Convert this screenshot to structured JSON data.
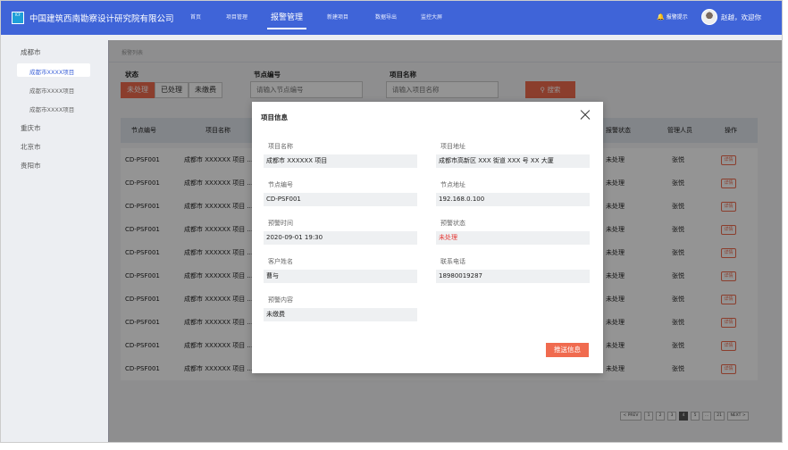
{
  "header": {
    "logo_text": "ICF",
    "org_name": "中国建筑西南勘察设计研究院有限公司",
    "nav": [
      "首页",
      "项目管理",
      "报警管理",
      "新建项目",
      "数据导出",
      "监控大屏"
    ],
    "alert_label": "报警提示",
    "welcome": "赵越，欢迎你"
  },
  "sidebar": {
    "groups": [
      {
        "label": "成都市",
        "children": [
          "成都市XXXX项目",
          "成都市XXXX项目",
          "成都市XXXX项目"
        ]
      },
      {
        "label": "重庆市"
      },
      {
        "label": "北京市"
      },
      {
        "label": "贵阳市"
      }
    ]
  },
  "main": {
    "breadcrumb": "报警列表",
    "filters": {
      "status_label": "状态",
      "status_options": [
        "未处理",
        "已处理",
        "未缴费"
      ],
      "node_label": "节点编号",
      "node_placeholder": "请输入节点编号",
      "project_label": "项目名称",
      "project_placeholder": "请输入项目名称",
      "search_label": "搜索"
    },
    "table": {
      "columns": [
        "节点编号",
        "项目名称",
        "报警状态",
        "管理人员",
        "操作"
      ],
      "rows": [
        {
          "node": "CD-PSF001",
          "project": "成都市 XXXXXX 项目 ...",
          "status": "未处理",
          "manager": "张悦",
          "action": "详情"
        },
        {
          "node": "CD-PSF001",
          "project": "成都市 XXXXXX 项目 ...",
          "status": "未处理",
          "manager": "张悦",
          "action": "详情"
        },
        {
          "node": "CD-PSF001",
          "project": "成都市 XXXXXX 项目 ...",
          "status": "未处理",
          "manager": "张悦",
          "action": "详情"
        },
        {
          "node": "CD-PSF001",
          "project": "成都市 XXXXXX 项目 ...",
          "status": "未处理",
          "manager": "张悦",
          "action": "详情"
        },
        {
          "node": "CD-PSF001",
          "project": "成都市 XXXXXX 项目 ...",
          "status": "未处理",
          "manager": "张悦",
          "action": "详情"
        },
        {
          "node": "CD-PSF001",
          "project": "成都市 XXXXXX 项目 ...",
          "status": "未处理",
          "manager": "张悦",
          "action": "详情"
        },
        {
          "node": "CD-PSF001",
          "project": "成都市 XXXXXX 项目 ...",
          "status": "未处理",
          "manager": "张悦",
          "action": "详情"
        },
        {
          "node": "CD-PSF001",
          "project": "成都市 XXXXXX 项目 ...",
          "status": "未处理",
          "manager": "张悦",
          "action": "详情"
        },
        {
          "node": "CD-PSF001",
          "project": "成都市 XXXXXX 项目 ...",
          "status": "未处理",
          "manager": "张悦",
          "action": "详情"
        },
        {
          "node": "CD-PSF001",
          "project": "成都市 XXXXXX 项目 ...",
          "status": "未处理",
          "manager": "张悦",
          "action": "详情"
        }
      ]
    },
    "pager": [
      "< PREV",
      "1",
      "2",
      "3",
      "4",
      "5",
      "...",
      "21",
      "NEXT >"
    ]
  },
  "modal": {
    "title": "项目信息",
    "fields": [
      {
        "label": "项目名称",
        "value": "成都市 XXXXXX 项目"
      },
      {
        "label": "项目地址",
        "value": "成都市高新区 XXX 街道 XXX 号 XX 大厦"
      },
      {
        "label": "节点编号",
        "value": "CD-PSF001"
      },
      {
        "label": "节点地址",
        "value": "192.168.0.100"
      },
      {
        "label": "预警时间",
        "value": "2020-09-01 19:30"
      },
      {
        "label": "预警状态",
        "value": "未处理"
      },
      {
        "label": "客户姓名",
        "value": "曹与"
      },
      {
        "label": "联系电话",
        "value": "18980019287"
      },
      {
        "label": "预警内容",
        "value": "未缴费"
      }
    ],
    "push_label": "推送信息"
  },
  "colors": {
    "brand": "#3f64d8",
    "accent": "#f06b4f",
    "alert": "#e53935"
  }
}
